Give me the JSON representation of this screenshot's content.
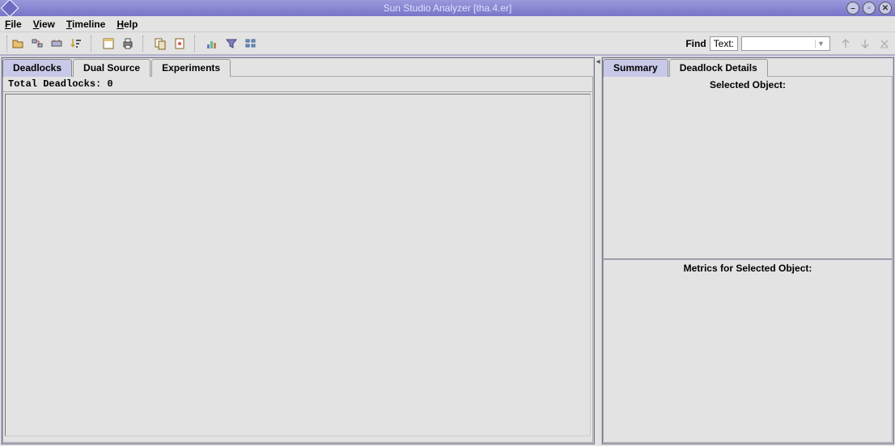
{
  "titlebar": {
    "title": "Sun Studio Analyzer [tha.4.er]"
  },
  "menubar": {
    "file": "File",
    "view": "View",
    "timeline": "Timeline",
    "help": "Help"
  },
  "toolbar": {
    "find_label": "Find",
    "find_mode": "Text:",
    "find_value": ""
  },
  "left": {
    "tabs": {
      "deadlocks": "Deadlocks",
      "dual_source": "Dual Source",
      "experiments": "Experiments"
    },
    "status": "Total Deadlocks: 0"
  },
  "right": {
    "tabs": {
      "summary": "Summary",
      "deadlock_details": "Deadlock Details"
    },
    "selected_object": "Selected Object:",
    "metrics": "Metrics for Selected Object:"
  }
}
